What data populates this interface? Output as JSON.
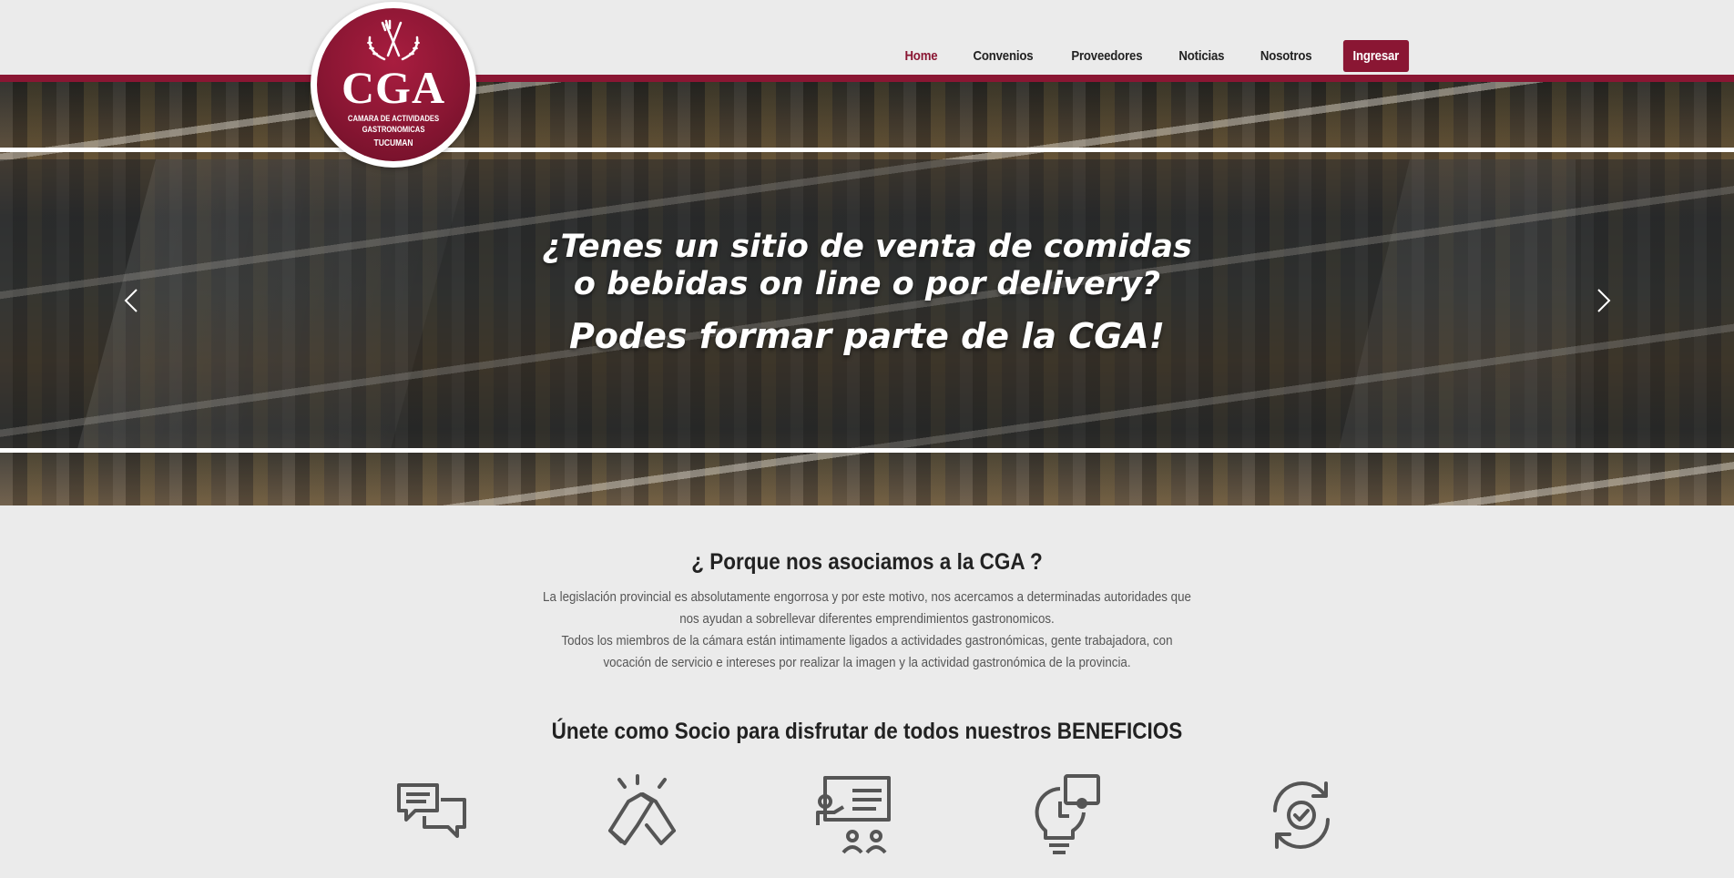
{
  "logo": {
    "title": "CGA",
    "line1": "CAMARA DE ACTIVIDADES",
    "line2": "GASTRONOMICAS",
    "line3": "TUCUMAN"
  },
  "nav": {
    "items": [
      {
        "label": "Home"
      },
      {
        "label": "Convenios"
      },
      {
        "label": "Proveedores"
      },
      {
        "label": "Noticias"
      },
      {
        "label": "Nosotros"
      }
    ],
    "login_label": "Ingresar"
  },
  "hero": {
    "line1": "¿Tenes un sitio de venta de comidas",
    "line2": "o bebidas on line o por delivery?",
    "line3": "Podes formar parte de la CGA!"
  },
  "about": {
    "title": "¿ Porque nos asociamos a la CGA ?",
    "paragraph1": "La legislación provincial es absolutamente engorrosa y por este motivo, nos acercamos a determinadas autoridades que nos ayudan a sobrellevar diferentes emprendimientos gastronomicos.",
    "paragraph2": "Todos los miembros de la cámara están intimamente ligados a actividades gastronómicas, gente trabajadora, con vocación de servicio e intereses por realizar la imagen y la actividad gastronómica de la provincia."
  },
  "benefits": {
    "title": "Únete como Socio para disfrutar de todos nuestros BENEFICIOS",
    "icons": [
      "chat-bubbles-icon",
      "handshake-icon",
      "presentation-icon",
      "lightbulb-puzzle-icon",
      "refresh-check-icon"
    ]
  },
  "colors": {
    "brand": "#8a1633",
    "background": "#ebebeb",
    "icon": "#555555"
  }
}
